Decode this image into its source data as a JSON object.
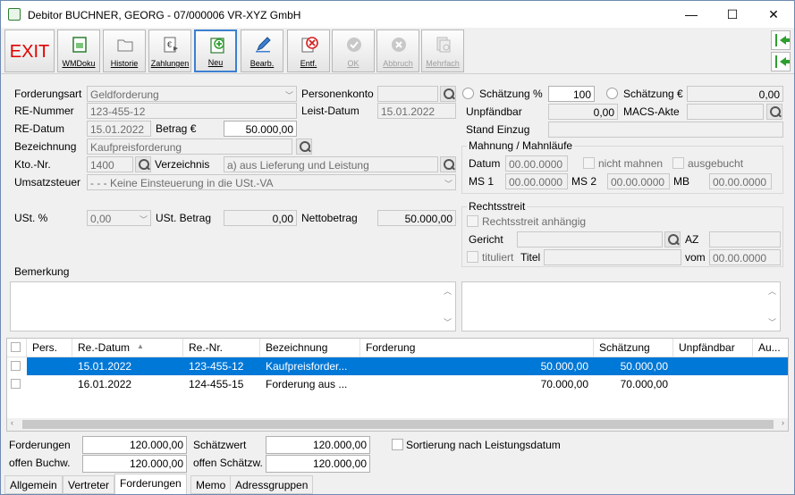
{
  "window": {
    "title": "Debitor BUCHNER, GEORG - 07/000006 VR-XYZ GmbH",
    "minimize": "—",
    "maximize": "☐",
    "close": "✕"
  },
  "toolbar": {
    "exit": "EXIT",
    "buttons": [
      {
        "label": "WMDoku",
        "icon": "document-green-icon"
      },
      {
        "label": "Historie",
        "icon": "folder-icon"
      },
      {
        "label": "Zahlungen",
        "icon": "payment-document-icon"
      },
      {
        "label": "Neu",
        "icon": "add-icon"
      },
      {
        "label": "Bearb.",
        "icon": "edit-pencil-icon"
      },
      {
        "label": "Entf.",
        "icon": "delete-icon"
      },
      {
        "label": "OK",
        "icon": "check-icon"
      },
      {
        "label": "Abbruch",
        "icon": "cancel-icon"
      },
      {
        "label": "Mehrfach",
        "icon": "multi-document-icon"
      }
    ]
  },
  "form": {
    "forderungsart_label": "Forderungsart",
    "forderungsart_value": "Geldforderung",
    "re_nummer_label": "RE-Nummer",
    "re_nummer_value": "123-455-12",
    "re_datum_label": "RE-Datum",
    "re_datum_value": "15.01.2022",
    "betrag_label": "Betrag €",
    "betrag_value": "50.000,00",
    "bezeichnung_label": "Bezeichnung",
    "bezeichnung_value": "Kaufpreisforderung",
    "kto_label": "Kto.-Nr.",
    "kto_value": "1400",
    "verzeichnis_label": "Verzeichnis",
    "verzeichnis_value": "a) aus Lieferung und Leistung",
    "umsatzsteuer_label": "Umsatzsteuer",
    "umsatzsteuer_value": "- - - Keine Einsteuerung in die USt.-VA",
    "ust_label": "USt. %",
    "ust_value": "0,00",
    "ust_betrag_label": "USt. Betrag",
    "ust_betrag_value": "0,00",
    "netto_label": "Nettobetrag",
    "netto_value": "50.000,00",
    "bemerkung_label": "Bemerkung",
    "personenkonto_label": "Personenkonto",
    "personenkonto_value": "",
    "leist_datum_label": "Leist-Datum",
    "leist_datum_value": "15.01.2022",
    "schaetzung_pct_label": "Schätzung %",
    "schaetzung_pct_value": "100",
    "schaetzung_eur_label": "Schätzung €",
    "schaetzung_eur_value": "0,00",
    "unpfaendbar_label": "Unpfändbar",
    "unpfaendbar_value": "0,00",
    "macs_label": "MACS-Akte",
    "macs_value": "",
    "stand_einzug_label": "Stand Einzug",
    "stand_einzug_value": ""
  },
  "mahnung": {
    "title": "Mahnung / Mahnläufe",
    "datum_label": "Datum",
    "datum_value": "00.00.0000",
    "nicht_mahnen": "nicht mahnen",
    "ausgebucht": "ausgebucht",
    "ms1_label": "MS 1",
    "ms1_value": "00.00.0000",
    "ms2_label": "MS 2",
    "ms2_value": "00.00.0000",
    "mb_label": "MB",
    "mb_value": "00.00.0000"
  },
  "rechtsstreit": {
    "title": "Rechtsstreit",
    "anhaengig": "Rechtsstreit anhängig",
    "gericht_label": "Gericht",
    "gericht_value": "",
    "az_label": "AZ",
    "az_value": "",
    "tituliert": "tituliert",
    "titel_label": "Titel",
    "titel_value": "",
    "vom_label": "vom",
    "vom_value": "00.00.0000"
  },
  "grid": {
    "columns": [
      "Pers.",
      "Re.-Datum",
      "Re.-Nr.",
      "Bezeichnung",
      "Forderung",
      "Schätzung",
      "Unpfändbar",
      "Au..."
    ],
    "sort_indicator": "▲",
    "rows": [
      {
        "pers": "",
        "datum": "15.01.2022",
        "nr": "123-455-12",
        "bez": "Kaufpreisforder...",
        "forderung": "50.000,00",
        "schaetzung": "50.000,00",
        "unpf": "",
        "au": ""
      },
      {
        "pers": "",
        "datum": "16.01.2022",
        "nr": "124-455-15",
        "bez": "Forderung aus ...",
        "forderung": "70.000,00",
        "schaetzung": "70.000,00",
        "unpf": "",
        "au": ""
      }
    ]
  },
  "summary": {
    "forderungen_label": "Forderungen",
    "forderungen_value": "120.000,00",
    "offen_buchw_label": "offen Buchw.",
    "offen_buchw_value": "120.000,00",
    "schaetzwert_label": "Schätzwert",
    "schaetzwert_value": "120.000,00",
    "offen_schaetzw_label": "offen Schätzw.",
    "offen_schaetzw_value": "120.000,00",
    "sortierung": "Sortierung nach Leistungsdatum"
  },
  "tabs": [
    "Allgemein",
    "Vertreter",
    "Forderungen",
    "Memo",
    "Adressgruppen"
  ],
  "active_tab": "Forderungen",
  "colors": {
    "selection": "#0078d7",
    "exit": "#e00000",
    "accent_green": "#2e9e2e"
  }
}
